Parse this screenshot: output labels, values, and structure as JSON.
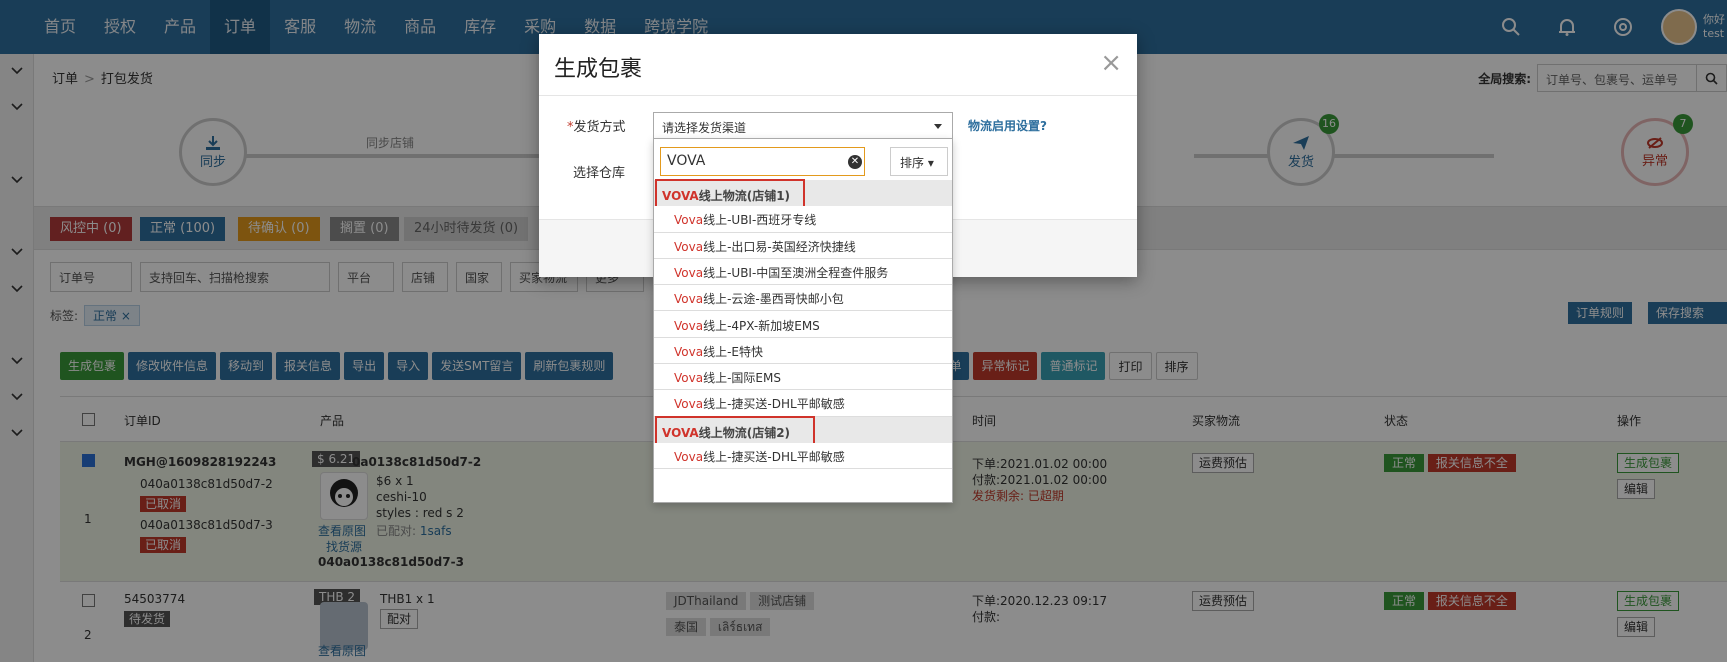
{
  "topnav": {
    "items": [
      "首页",
      "授权",
      "产品",
      "订单",
      "客服",
      "物流",
      "商品",
      "库存",
      "采购",
      "数据",
      "跨境学院"
    ],
    "active_index": 3,
    "user_text": "你好 test"
  },
  "breadcrumb": {
    "root": "订单",
    "current": "打包发货"
  },
  "global_search": {
    "label": "全局搜索:",
    "placeholder": "订单号、包裹号、运单号"
  },
  "steps": {
    "sync_label": "同步",
    "sync_store": "同步店铺",
    "ship_label": "发货",
    "ship_count": "16",
    "abnormal_label": "异常",
    "abnormal_count": "7"
  },
  "status_chips": [
    "风控中 (0)",
    "正常 (100)",
    "待确认 (0)",
    "搁置 (0)",
    "24小时待发货 (0)"
  ],
  "filters": {
    "order_no": "订单号",
    "search_placeholder": "支持回车、扫描枪搜索",
    "platform": "平台",
    "store": "店铺",
    "country": "国家",
    "buyer_logistics": "买家物流",
    "more": "更多"
  },
  "tagline": {
    "label": "标签:",
    "tag": "正常"
  },
  "right_buttons": {
    "order_rules": "订单规则",
    "save_search": "保存搜索"
  },
  "actions": [
    "生成包裹",
    "修改收件信息",
    "移动到",
    "报关信息",
    "导出",
    "导入",
    "发送SMT留言",
    "刷新包裹规则",
    "单",
    "取消订单",
    "异常标记",
    "普通标记",
    "打印",
    "排序"
  ],
  "table": {
    "headers": [
      "订单ID",
      "产品",
      "时间",
      "买家物流",
      "状态",
      "操作"
    ],
    "row1": {
      "index": "1",
      "order_id": "MGH@1609828192243",
      "sub1": "040a0138c81d50d7-2",
      "sub1_tag": "已取消",
      "sub2": "040a0138c81d50d7-3",
      "sub2_tag": "已取消",
      "price_tag": "$ 6.21",
      "prod_id": "0a0138c81d50d7-2",
      "prod_price": "$6 x 1",
      "prod_name": "ceshi-10",
      "prod_style": "styles : red s 2",
      "prod_paired_label": "已配对:",
      "prod_paired": "1safs",
      "view_img": "查看原图",
      "find_src": "找货源",
      "prod_id2": "040a0138c81d50d7-3",
      "time_order": "下单:2021.01.02 00:00",
      "time_pay": "付款:2021.01.02 00:00",
      "time_remain": "发货剩余: 已超期",
      "freight": "运费预估",
      "status_ok": "正常",
      "status_warn": "报关信息不全",
      "op_gen": "生成包裹",
      "op_edit": "编辑"
    },
    "row2": {
      "index": "2",
      "order_id": "54503774",
      "status_tag": "待发货",
      "price_tag": "THB 2",
      "prod_name": "THB1 x 1",
      "paired": "配对",
      "view_img": "查看原图",
      "store1": "JDThailand",
      "store2": "测试店铺",
      "country": "泰国",
      "buyer": "เลิร์ธเทส",
      "time_order": "下单:2020.12.23 09:17",
      "time_pay": "付款:",
      "freight": "运费预估",
      "status_ok": "正常",
      "status_warn": "报关信息不全",
      "op_gen": "生成包裹",
      "op_edit": "编辑"
    }
  },
  "modal": {
    "title": "生成包裹",
    "close": "×",
    "ship_method_label": "发货方式",
    "ship_method_placeholder": "请选择发货渠道",
    "warehouse_label": "选择仓库",
    "logistics_link": "物流启用设置?"
  },
  "dropdown": {
    "search_value": "VOVA",
    "sort_label": "排序",
    "groups": [
      {
        "hl": "VOVA",
        "rest": "线上物流(店铺1)",
        "options": [
          "线上-UBI-西班牙专线",
          "线上-出口易-英国经济快捷线",
          "线上-UBI-中国至澳洲全程查件服务",
          "线上-云途-墨西哥快邮小包",
          "线上-4PX-新加坡EMS",
          "线上-E特快",
          "线上-国际EMS",
          "线上-捷买送-DHL平邮敏感"
        ]
      },
      {
        "hl": "VOVA",
        "rest": "线上物流(店铺2)",
        "options": [
          "线上-捷买送-DHL平邮敏感"
        ]
      }
    ],
    "option_prefix": "Vova"
  }
}
